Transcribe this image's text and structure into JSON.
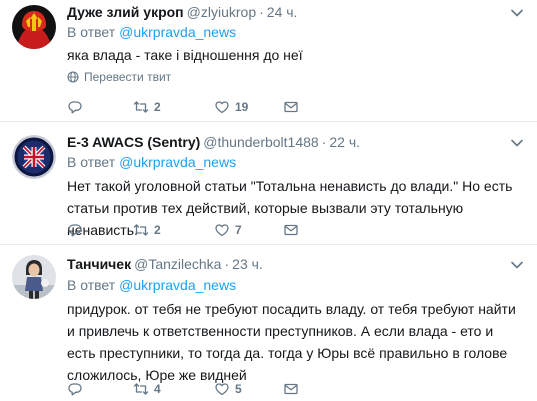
{
  "tweets": [
    {
      "name": "Дуже злий укроп",
      "handle": "@zlyiukrop",
      "dot": "·",
      "time": "24 ч.",
      "reply_prefix": "В ответ",
      "reply_to": "@ukrpravda_news",
      "text": "яка влада - таке і відношення до неї",
      "translate_label": "Перевести твит",
      "reply_count": "",
      "retweet_count": "2",
      "like_count": "19"
    },
    {
      "name": "E-3 AWACS (Sentry)",
      "handle": "@thunderbolt1488",
      "dot": "·",
      "time": "22 ч.",
      "reply_prefix": "В ответ",
      "reply_to": "@ukrpravda_news",
      "text": "Нет такой уголовной статьи \"Тотальна ненависть до влади.\" Но есть статьи против тех действий, которые вызвали эту тотальную ненависть.",
      "reply_count": "",
      "retweet_count": "2",
      "like_count": "7"
    },
    {
      "name": "Танчичек",
      "handle": "@Tanzilechka",
      "dot": "·",
      "time": "23 ч.",
      "reply_prefix": "В ответ",
      "reply_to": "@ukrpravda_news",
      "text": "придурок. от тебя не требуют посадить владу. от тебя требуют найти и привлечь к ответственности преступников. А если влада - ето и есть преступники, то тогда да. тогда у Юры всё правильно в голове сложилось, Юре же видней",
      "reply_count": "",
      "retweet_count": "4",
      "like_count": "5"
    }
  ],
  "icons": {
    "reply": "reply-icon",
    "retweet": "retweet-icon",
    "like": "heart-icon",
    "dm": "envelope-icon",
    "menu": "chevron-down-icon",
    "translate": "globe-icon"
  },
  "colors": {
    "text": "#14171a",
    "muted": "#657786",
    "link": "#1da1f2",
    "divider": "#e6ecf0"
  }
}
